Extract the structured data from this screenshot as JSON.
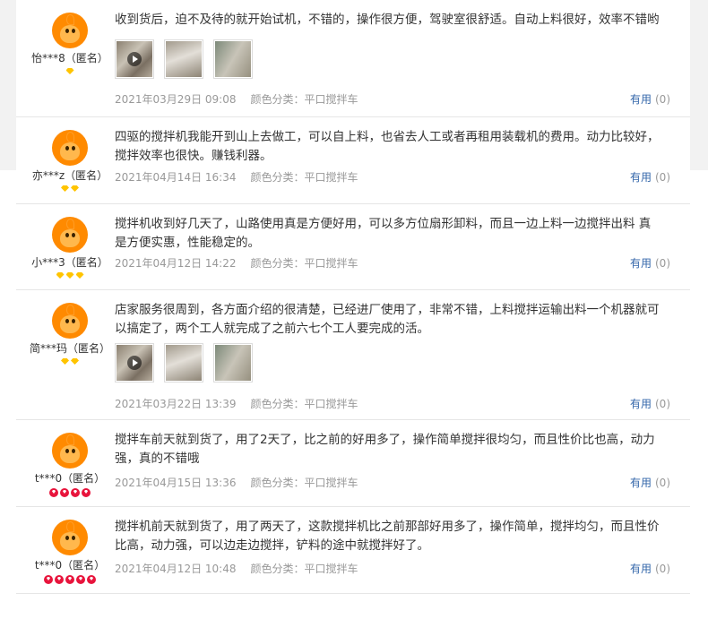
{
  "reviews": [
    {
      "user": "怡***8（匿名）",
      "level": {
        "type": "yellow",
        "count": 1
      },
      "text": "收到货后，迫不及待的就开始试机，不错的，操作很方便，驾驶室很舒适。自动上料很好，效率不错哟",
      "photos": [
        {
          "video": true,
          "icon": "play-icon"
        },
        {
          "video": false
        },
        {
          "video": false
        }
      ],
      "date": "2021年03月29日 09:08",
      "color_label": "颜色分类：平口搅拌车",
      "helpful_label": "有用",
      "helpful_count": "(0)"
    },
    {
      "user": "亦***z（匿名）",
      "level": {
        "type": "yellow",
        "count": 2
      },
      "text": "四驱的搅拌机我能开到山上去做工，可以自上料，也省去人工或者再租用装载机的费用。动力比较好，\n搅拌效率也很快。赚钱利器。",
      "photos": [],
      "date": "2021年04月14日 16:34",
      "color_label": "颜色分类：平口搅拌车",
      "helpful_label": "有用",
      "helpful_count": "(0)"
    },
    {
      "user": "小***3（匿名）",
      "level": {
        "type": "yellow",
        "count": 3
      },
      "text": "搅拌机收到好几天了，山路使用真是方便好用，可以多方位扇形卸料，而且一边上料一边搅拌出料 真\n是方便实惠，性能稳定的。",
      "photos": [],
      "date": "2021年04月12日 14:22",
      "color_label": "颜色分类：平口搅拌车",
      "helpful_label": "有用",
      "helpful_count": "(0)"
    },
    {
      "user": "简***玛（匿名）",
      "level": {
        "type": "yellow",
        "count": 2
      },
      "text": "店家服务很周到，各方面介绍的很清楚，已经进厂使用了，非常不错，上料搅拌运输出料一个机器就可\n以搞定了，两个工人就完成了之前六七个工人要完成的活。",
      "photos": [
        {
          "video": true,
          "icon": "play-icon"
        },
        {
          "video": false
        },
        {
          "video": false
        }
      ],
      "date": "2021年03月22日 13:39",
      "color_label": "颜色分类：平口搅拌车",
      "helpful_label": "有用",
      "helpful_count": "(0)"
    },
    {
      "user": "t***0（匿名）",
      "level": {
        "type": "red",
        "count": 4
      },
      "text": "搅拌车前天就到货了，用了2天了，比之前的好用多了，操作简单搅拌很均匀，而且性价比也高，动力\n强，真的不错哦",
      "photos": [],
      "date": "2021年04月15日 13:36",
      "color_label": "颜色分类：平口搅拌车",
      "helpful_label": "有用",
      "helpful_count": "(0)"
    },
    {
      "user": "t***0（匿名）",
      "level": {
        "type": "red",
        "count": 5
      },
      "text": "搅拌机前天就到货了，用了两天了，这款搅拌机比之前那部好用多了，操作简单，搅拌均匀，而且性价\n比高，动力强，可以边走边搅拌，铲料的途中就搅拌好了。",
      "photos": [],
      "date": "2021年04月12日 10:48",
      "color_label": "颜色分类：平口搅拌车",
      "helpful_label": "有用",
      "helpful_count": "(0)"
    }
  ],
  "colors": {
    "avatar": "#ff8a00",
    "yellow_gem": "#ffc400",
    "red_gem": "#e8143c",
    "helpful_link": "#3366aa",
    "meta_text": "#999999"
  }
}
